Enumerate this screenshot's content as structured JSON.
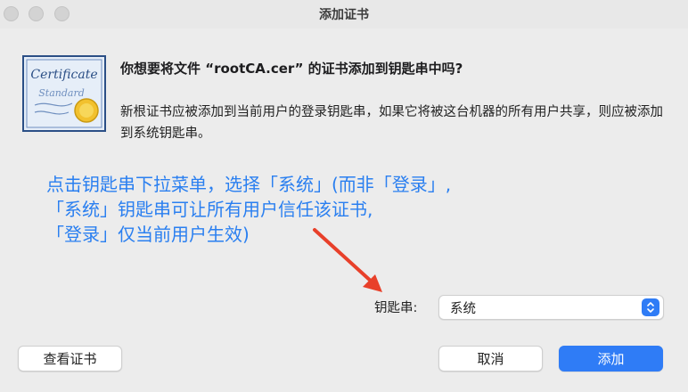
{
  "window": {
    "title": "添加证书"
  },
  "icon": {
    "name": "certificate-icon",
    "script_line1": "Certificate",
    "script_line2": "Standard"
  },
  "dialog": {
    "question": "你想要将文件 “rootCA.cer” 的证书添加到钥匙串中吗?",
    "info": "新根证书应被添加到当前用户的登录钥匙串，如果它将被这台机器的所有用户共享，则应被添加到系统钥匙串。"
  },
  "annotation": {
    "line1": "点击钥匙串下拉菜单，选择「系统」(而非「登录」,",
    "line2": "「系统」钥匙串可让所有用户信任该证书,",
    "line3": "「登录」仅当前用户生效)",
    "color": "#2a7ff0",
    "arrow_color": "#e8402a"
  },
  "keychain": {
    "label": "钥匙串:",
    "selected": "系统"
  },
  "buttons": {
    "view_certificate": "查看证书",
    "cancel": "取消",
    "add": "添加"
  },
  "colors": {
    "accent": "#2f7cf6"
  }
}
